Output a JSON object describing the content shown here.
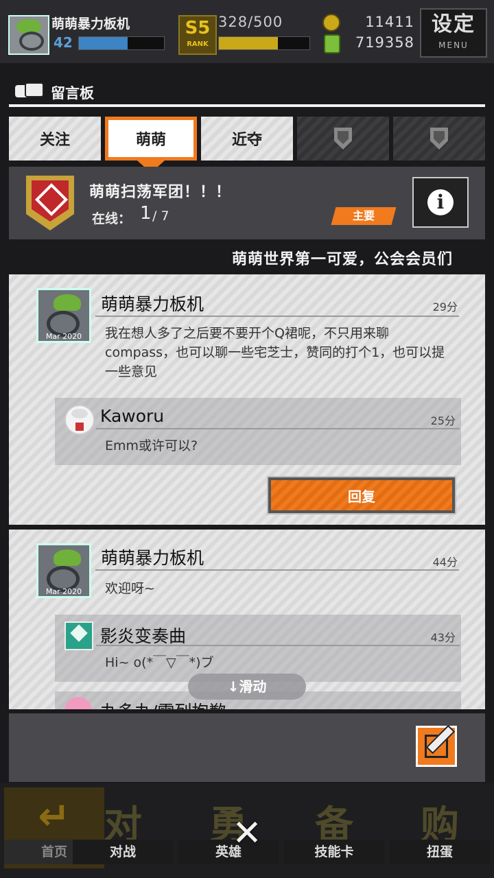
{
  "topbar": {
    "player_name": "萌萌暴力板机",
    "level": "42",
    "level_progress": 0.57,
    "rank_badge": "S5",
    "rank_badge_caption": "RANK",
    "rank_points": "328/500",
    "rank_progress": 0.65,
    "coins": "11411",
    "gems": "719358",
    "menu_title": "设定",
    "menu_caption": "MENU",
    "avatar_caption": "Mar 2020"
  },
  "board": {
    "title": "留言板"
  },
  "tabs": [
    {
      "label": "关注"
    },
    {
      "label": "萌萌"
    },
    {
      "label": "近夺"
    },
    {
      "label": ""
    },
    {
      "label": ""
    }
  ],
  "guild": {
    "name": "萌萌扫荡军团！！！",
    "online_label": "在线：",
    "online_count": "1",
    "online_total": "/ 7",
    "tag": "主要",
    "ticker": "萌萌世界第一可爱，公会会员们"
  },
  "posts": [
    {
      "author": "萌萌暴力板机",
      "avatar_caption": "Mar 2020",
      "time": "29分",
      "text": "我在想人多了之后要不要开个Q裙呢，不只用来聊compass，也可以聊一些宅芝士，赞同的打个1，也可以提一些意见",
      "replies": [
        {
          "author": "Kaworu",
          "time": "25分",
          "text": "Emm或许可以?"
        }
      ],
      "reply_button": "回复"
    },
    {
      "author": "萌萌暴力板机",
      "avatar_caption": "Mar 2020",
      "time": "44分",
      "text": "欢迎呀~",
      "replies": [
        {
          "author": "影炎变奏曲",
          "time": "43分",
          "text": "Hi~  o(*￣▽￣*)ブ"
        },
        {
          "author": "丸多丸/雷列抱歉",
          "time": "",
          "text": ""
        }
      ]
    }
  ],
  "scroll_hint": "↓滑动",
  "bottom_nav": [
    {
      "label": "首页",
      "glyph": "↵"
    },
    {
      "label": "对战",
      "glyph": "对"
    },
    {
      "label": "英雄",
      "glyph": "勇"
    },
    {
      "label": "技能卡",
      "glyph": "备"
    },
    {
      "label": "扭蛋",
      "glyph": "购"
    }
  ],
  "close_glyph": "✕",
  "colors": {
    "accent": "#f07a1e",
    "panel": "#404044",
    "gold": "#e8c21e"
  }
}
